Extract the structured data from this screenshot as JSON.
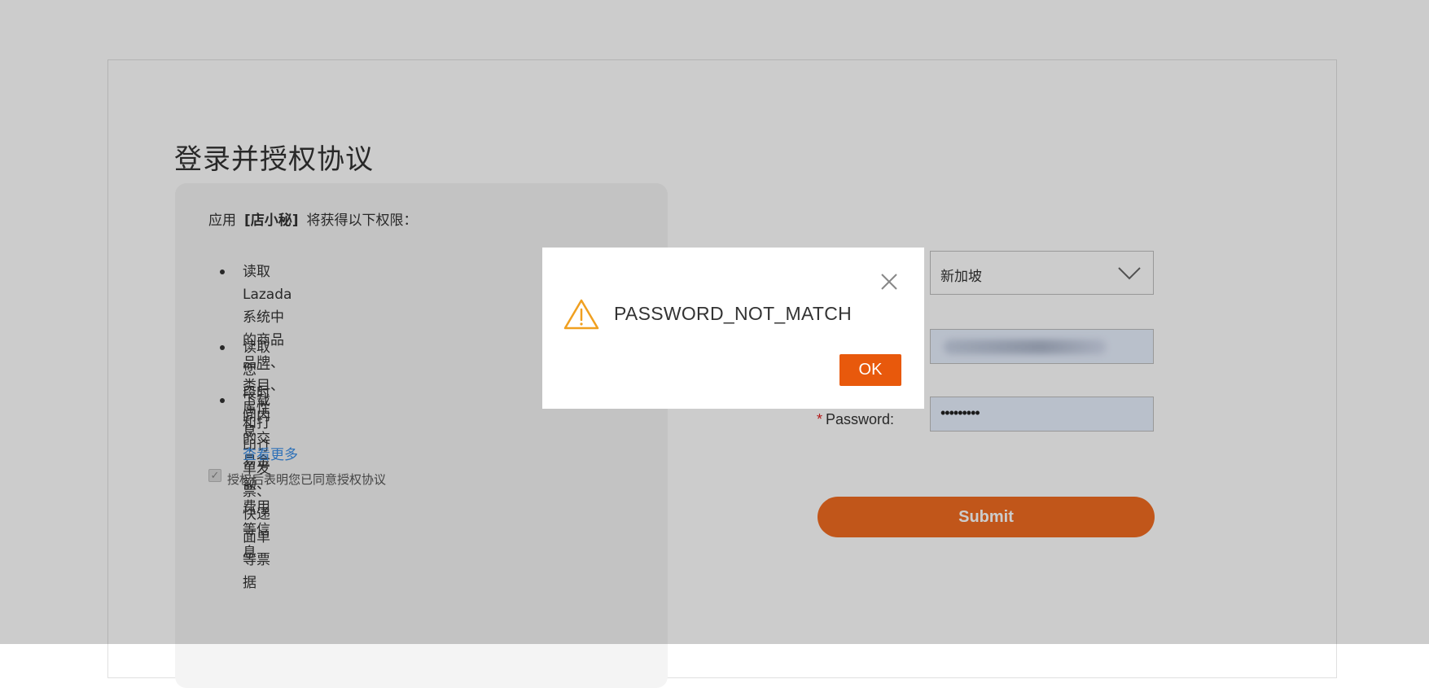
{
  "page": {
    "title": "登录并授权协议"
  },
  "permissions": {
    "intro_prefix": "应用",
    "app_name": "[店小秘]",
    "intro_suffix": "将获得以下权限：",
    "items": [
      {
        "line1": "读取Lazada系统中的商品品牌、类目、属性",
        "line2": "息"
      },
      {
        "line1": "读取您一段时间内的交易金额、费用等信息"
      },
      {
        "line1": "下载和打印订单发票、快递面单等票据"
      }
    ],
    "view_more": "查看更多",
    "agree_text": "授权后表明您已同意授权协议"
  },
  "form": {
    "country_value": "新加坡",
    "username_value": "",
    "password_label": "Password:",
    "password_required_mark": "*",
    "password_value": "•••••••••",
    "submit_label": "Submit"
  },
  "modal": {
    "message": "PASSWORD_NOT_MATCH",
    "ok_label": "OK"
  },
  "colors": {
    "accent": "#f26c21",
    "modal_ok": "#e8590c",
    "warning": "#f0a020",
    "link": "#3a8ee6"
  }
}
